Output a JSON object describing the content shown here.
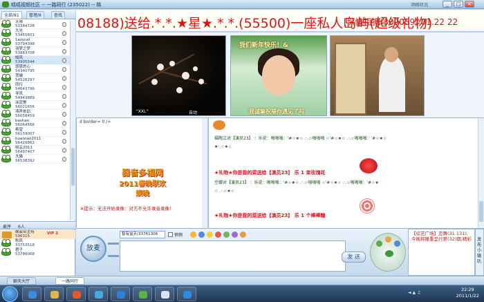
{
  "window": {
    "title": "呱呱视频社区 -- 一路同行 (235022) -- 晓",
    "network_label": "网络状况",
    "buttons": [
      "_",
      "□",
      "×"
    ]
  },
  "marquee": {
    "main_text": "08188)送给.*.*.★星★.*.*.(55500)一座私人岛屿(超级礼物)",
    "side_text": "[深情相拥(309059) 01.22 22"
  },
  "sidebar": {
    "tabs": [
      "全部/81",
      "管理/8",
      "查找"
    ],
    "users": [
      {
        "name": "无限",
        "id": "53384728"
      },
      {
        "name": "大光",
        "id": "53455601"
      },
      {
        "name": "1azycat",
        "id": "53794398"
      },
      {
        "name": "羽梦之梦",
        "id": "53883708"
      },
      {
        "name": "知风",
        "id": "53905544",
        "selected": true
      },
      {
        "name": "感恩的心",
        "id": "54340795"
      },
      {
        "name": "顶端",
        "id": "54528297"
      },
      {
        "name": "同行",
        "id": "54643796"
      },
      {
        "name": "寻风",
        "id": "54943889"
      },
      {
        "name": "涂武警",
        "id": "56021656"
      },
      {
        "name": "涛声依旧",
        "id": "56058459"
      },
      {
        "name": "bashao",
        "id": "56064566"
      },
      {
        "name": "希望",
        "id": "56159007"
      },
      {
        "name": "huaixiao2011",
        "id": "56429862"
      },
      {
        "name": "晓云2011",
        "id": "56497407"
      },
      {
        "name": "大猫",
        "id": "56538392"
      }
    ],
    "queue_header": [
      "麦序",
      "6人"
    ],
    "queue": [
      {
        "name": "晚会众主持",
        "id": "596315",
        "vip": "VIP 2",
        "host": true
      },
      {
        "name": "秋风",
        "id": "33753518"
      },
      {
        "name": "君子",
        "id": "53786068"
      }
    ]
  },
  "videos": [
    {
      "caption_left": "\"XXL\"",
      "caption_right": "自动"
    },
    {
      "top_text": "我们新年快乐！&",
      "bottom_text": "我诚挚祝福你遇见了吗"
    },
    {}
  ],
  "left_panel": {
    "code": "d border= 0 />",
    "poster_line1": "器音多福网",
    "poster_line2": "2011春晚联欢",
    "poster_line3": "娱晚",
    "note": "※提示：无法开始录像：对方不允许录音录像！"
  },
  "chat": {
    "lines": [
      {
        "text": "福陶江对【演员23】 ：乐说：啪啪啪：'#☆★☆ .·.☆啪啪啪 ☆'#☆★☆ .·.☆啪啪啪：'#☆★☆"
      },
      {
        "text": "★·.☆★☆"
      },
      {
        "text": "★礼物★你是我的菜送给【演员23】 乐 1 束玫瑰花",
        "gift": true
      },
      {
        "text": "空蝉对【演员23】 ：乐说：啪啪啪：'#☆★☆ .·.☆啪啪啪 ☆'#☆★☆ .·.☆啪啪啪：'#☆★"
      },
      {
        "text": "☆ .·.☆★☆"
      },
      {
        "text": "★礼物★你是我的菜送给【演员23】 乐 1 个棒棒糖",
        "gift": true
      }
    ]
  },
  "controls": {
    "mic_label": "放麦",
    "target": "智有益天(33761306",
    "private_label": "悄悄",
    "send_label": "发 送",
    "input_value": ""
  },
  "notice": {
    "text": "【综艺广场】恋舞(31 131);今晚将隆重呈行第(32)期,精彩"
  },
  "broadcast": {
    "label": "发布小喇叭"
  },
  "bottom_tabs": [
    "聊天大厅",
    "一路同行"
  ],
  "taskbar": {
    "time": "22:29",
    "date": "2011/1/22",
    "tray_label": "◄ ▲ ♫"
  },
  "colors": {
    "marquee_text": "#e01313",
    "gift_text": "#d6141a",
    "poster_gold": "#e5a51c"
  },
  "icons": [
    "app-icon",
    "frog-avatar",
    "microphone-icon",
    "send-icon",
    "start-icon"
  ]
}
